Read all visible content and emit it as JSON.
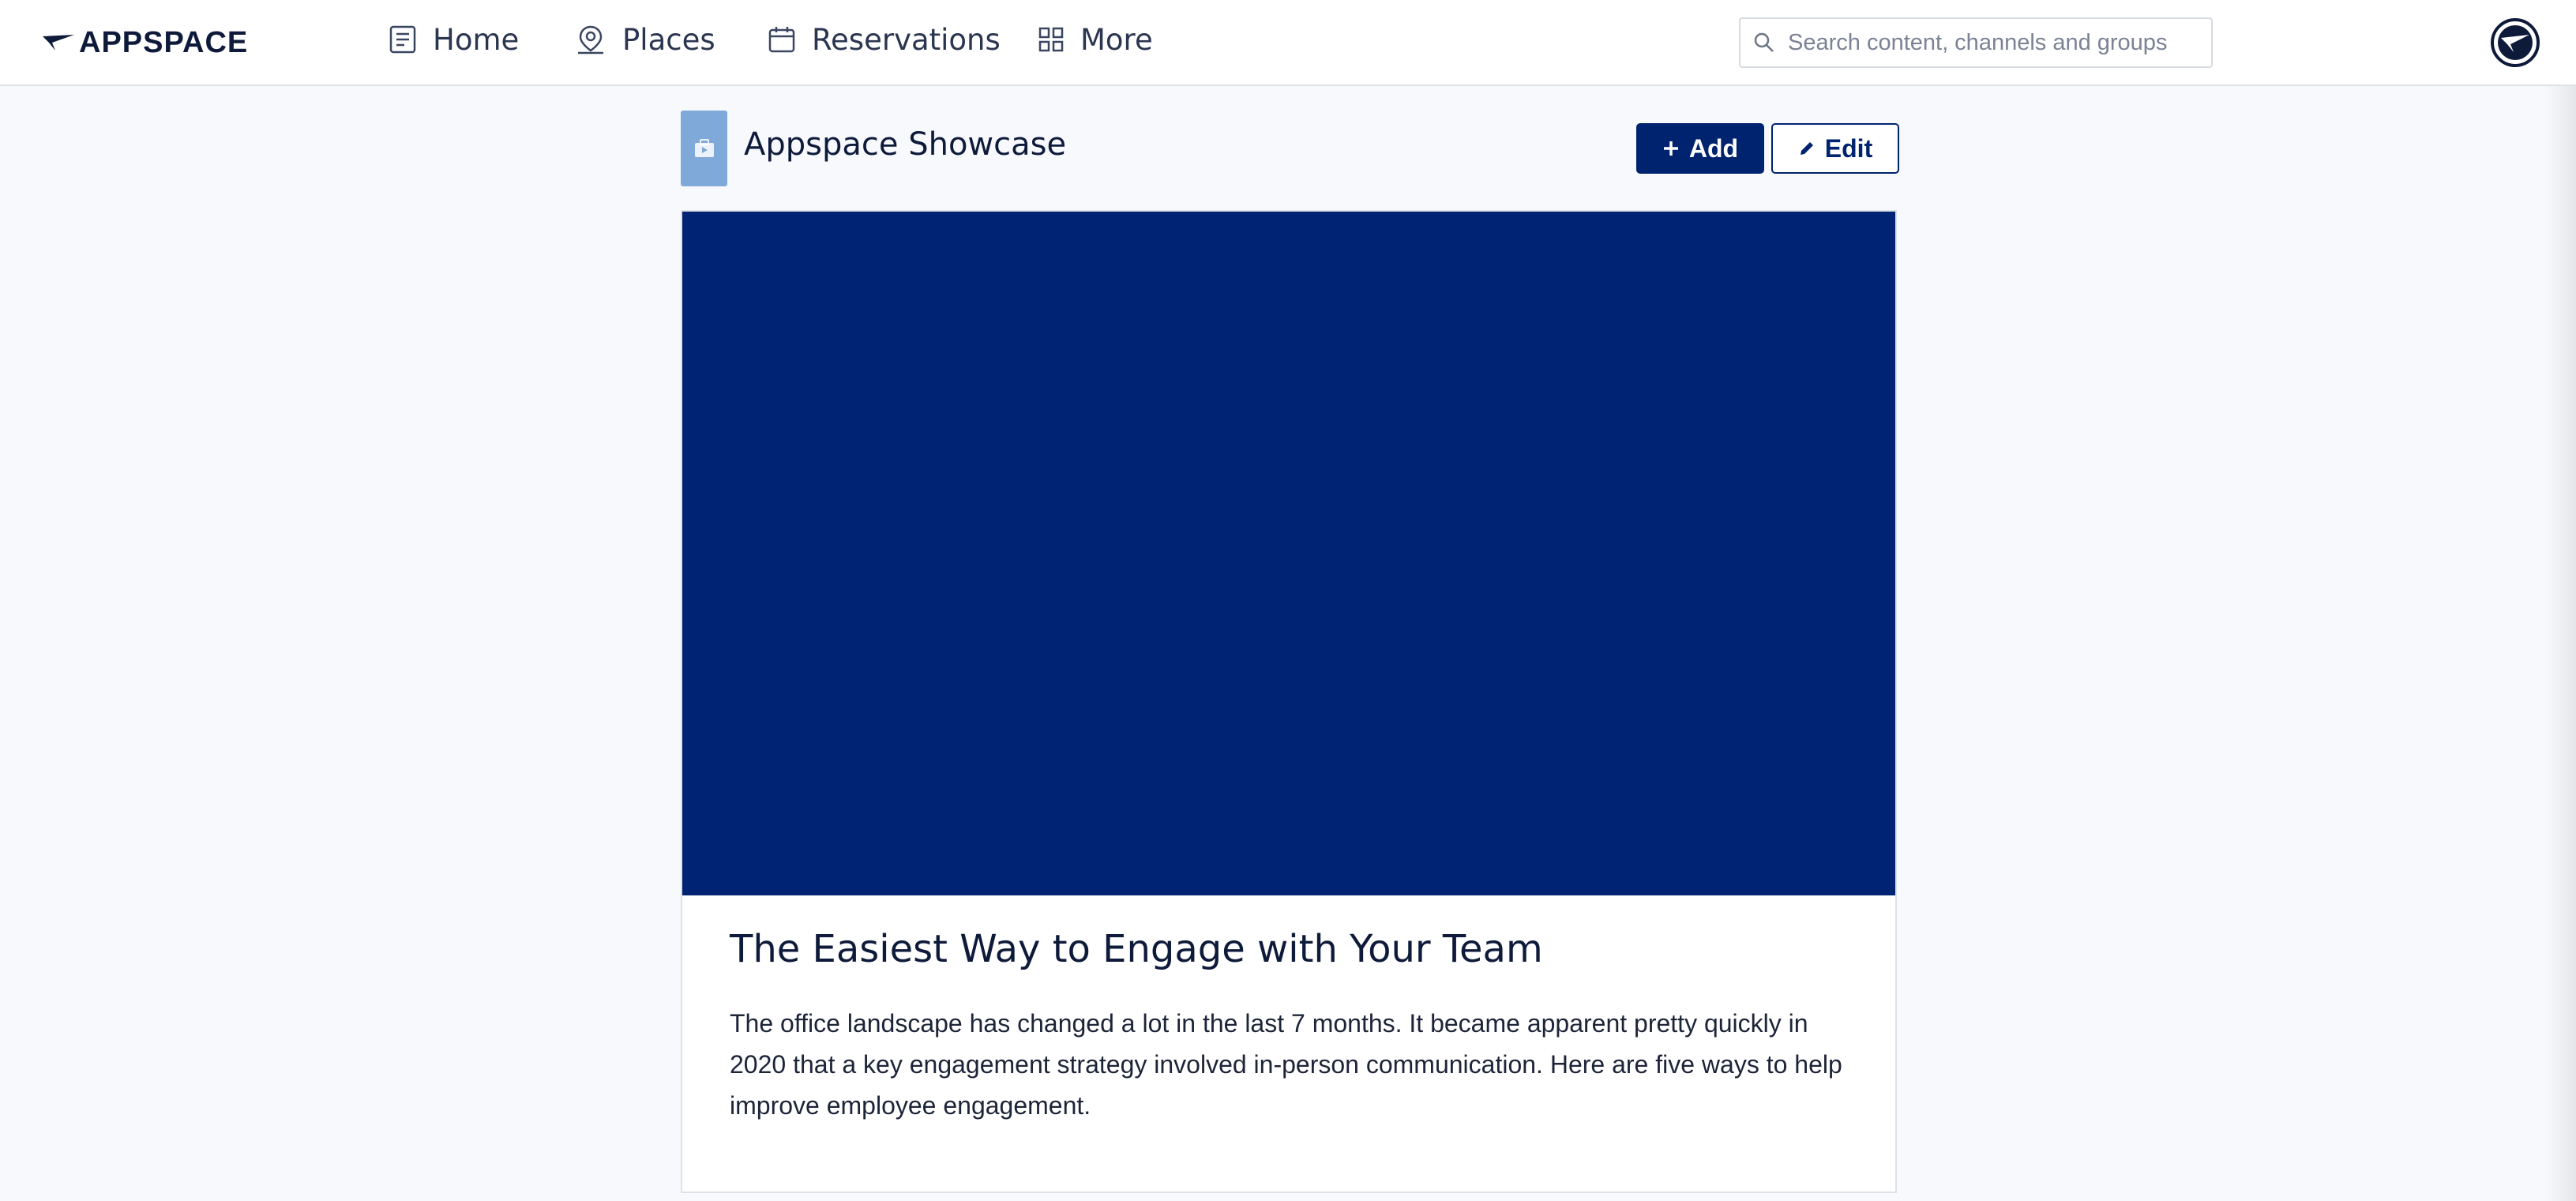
{
  "brand": {
    "logo_text": "APPSPACE"
  },
  "nav": {
    "items": [
      {
        "label": "Home",
        "icon": "news-icon"
      },
      {
        "label": "Places",
        "icon": "map-pin-icon"
      },
      {
        "label": "Reservations",
        "icon": "calendar-icon"
      },
      {
        "label": "More",
        "icon": "grid-icon"
      }
    ]
  },
  "search": {
    "placeholder": "Search content, channels and groups"
  },
  "channel": {
    "title": "Appspace Showcase",
    "add_label": "Add",
    "edit_label": "Edit"
  },
  "post": {
    "title": "The Easiest Way to Engage with Your Team",
    "body": "The office landscape has changed a lot in the last 7 months. It became apparent pretty quickly in 2020 that a key engagement strategy involved in-person communication. Here are five ways to help improve employee engagement."
  },
  "colors": {
    "brand_navy": "#00236f",
    "hero_background": "#002373",
    "channel_thumb": "#7fa9d8"
  }
}
